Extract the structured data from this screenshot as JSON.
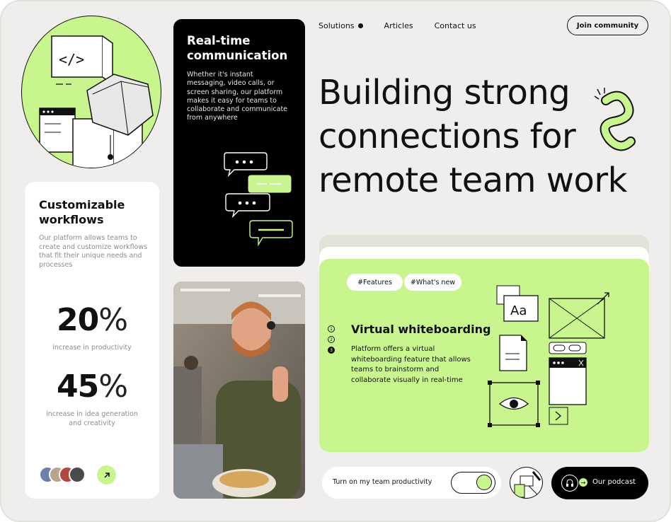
{
  "nav": {
    "items": [
      {
        "label": "Solutions",
        "has_dot": true
      },
      {
        "label": "Articles"
      },
      {
        "label": "Contact us"
      }
    ],
    "join_label": "Join community"
  },
  "hero": {
    "headline_lines": [
      "Building strong",
      "connections for",
      "remote team work"
    ]
  },
  "workflows_card": {
    "title": "Customizable workflows",
    "description": "Our platform allows teams to create and customize workflows that fit their unique needs and processes",
    "stats": [
      {
        "value": "20",
        "unit": "%",
        "caption": "increase in productivity"
      },
      {
        "value": "45",
        "unit": "%",
        "caption": "increase in idea generation and creativity"
      }
    ],
    "arrow_icon": "arrow-up-right-icon"
  },
  "communication_card": {
    "title": "Real-time communication",
    "description": "Whether it's instant messaging, video calls, or screen sharing, our platform makes it easy for teams to collaborate and communicate from anywhere"
  },
  "feature_card": {
    "tags": [
      "#Features",
      "#What's new"
    ],
    "steps": [
      "1",
      "2",
      "3"
    ],
    "active_step": 3,
    "title": "Virtual whiteboarding",
    "description": "Platform offers a virtual whiteboarding feature that allows teams to brainstorm and collaborate visually in real-time",
    "illustration_text": "Aa"
  },
  "bottom_bar": {
    "toggle_label": "Turn on my  team productivity",
    "toggle_on": true,
    "podcast_label": "Our podcast"
  },
  "colors": {
    "accent_green": "#c9f58e",
    "background": "#efeeec",
    "dark": "#000000"
  }
}
